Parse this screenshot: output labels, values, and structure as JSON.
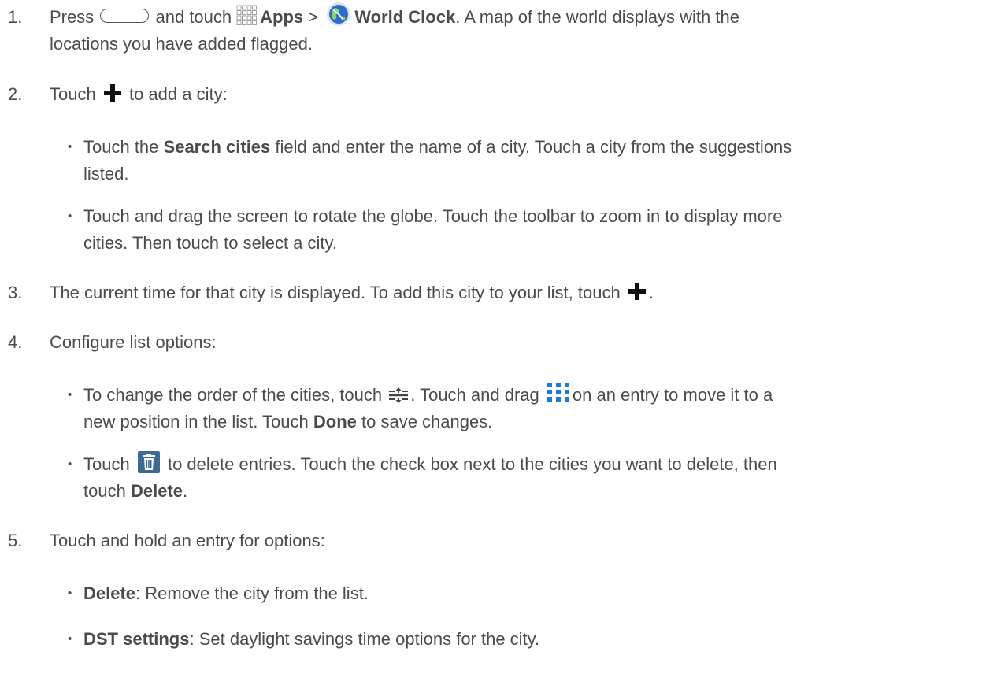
{
  "steps": [
    {
      "number": "1.",
      "press": "Press",
      "and_touch": "and touch",
      "apps": "Apps",
      "separator": ">",
      "world_clock": "World Clock",
      "rest_1": ". A map of the world displays with the",
      "rest_2": "locations you have added flagged."
    },
    {
      "number": "2.",
      "touch": "Touch",
      "rest": "to add a city:",
      "bullets": [
        {
          "pre": "Touch the",
          "bold": "Search cities",
          "line1": "field and enter the name of a city. Touch a city from the suggestions",
          "line2": "listed."
        },
        {
          "line1": "Touch and drag the screen to rotate the globe. Touch the toolbar to zoom in to display more",
          "line2": "cities. Then touch to select a city."
        }
      ]
    },
    {
      "number": "3.",
      "text": "The current time for that city is displayed. To add this city to your list, touch",
      "period": "."
    },
    {
      "number": "4.",
      "text": "Configure list options:",
      "bullets": [
        {
          "part1": "To change the order of the cities, touch",
          "part2": ". Touch and drag",
          "part3": "on an entry to move it to a",
          "line2_pre": "new position in the list. Touch",
          "line2_bold": "Done",
          "line2_post": "to save changes."
        },
        {
          "pre": "Touch",
          "post": "to delete entries. Touch the check box next to the cities you want to delete, then",
          "line2_pre": "touch",
          "line2_bold": "Delete",
          "line2_post": "."
        }
      ]
    },
    {
      "number": "5.",
      "text": "Touch and hold an entry for options:",
      "bullets": [
        {
          "bold": "Delete",
          "text": ": Remove the city from the list."
        },
        {
          "bold": "DST settings",
          "text": ": Set daylight savings time options for the city."
        }
      ]
    }
  ],
  "bullet_glyph": "•",
  "colors": {
    "text": "#4b4b4b",
    "globe": "#2e6cc9",
    "trash_bg": "#3e6b95",
    "drag_dots": "#1e7ad6"
  },
  "icons": [
    "home-button-icon",
    "apps-grid-icon",
    "world-clock-globe-icon",
    "plus-icon",
    "reorder-icon",
    "drag-handle-icon",
    "trash-icon"
  ]
}
